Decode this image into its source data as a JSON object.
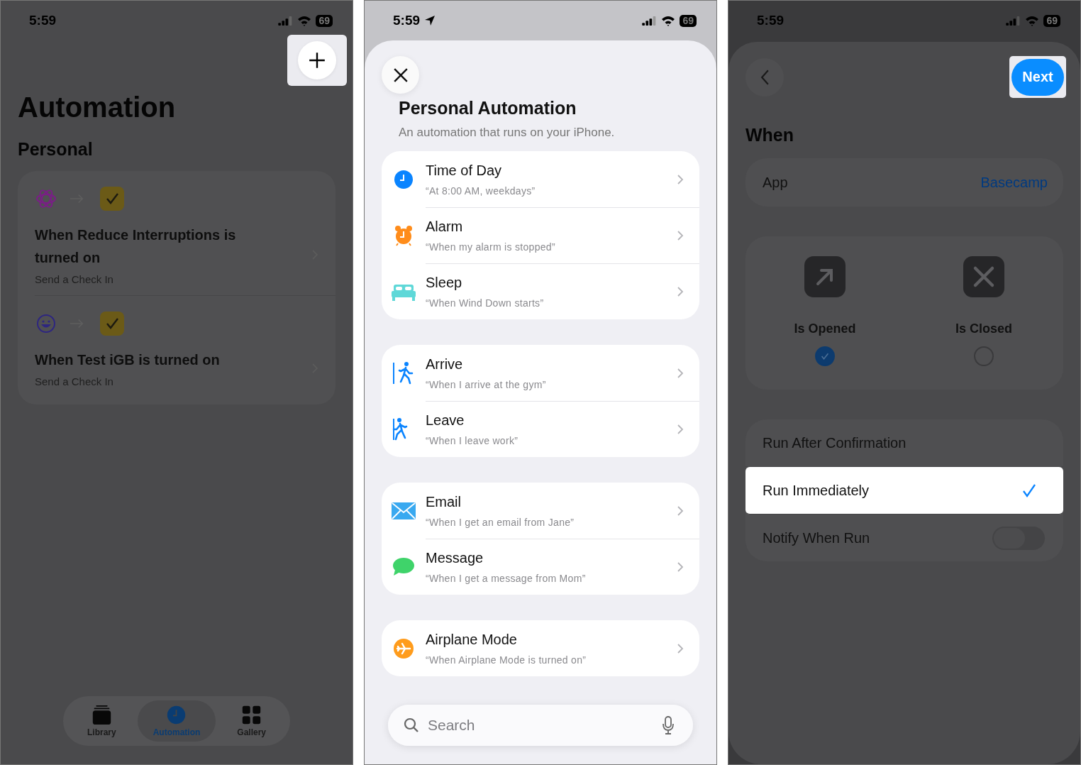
{
  "automation_screen": {
    "status_bar": {
      "time": "5:59",
      "battery": "69"
    },
    "title": "Automation",
    "section": "Personal",
    "automations": [
      {
        "kind": "flower",
        "title": "When Reduce Interruptions is turned on",
        "subtitle": "Send a Check In"
      },
      {
        "kind": "smiley",
        "title": "When Test iGB is turned on",
        "subtitle": "Send a Check In"
      }
    ],
    "tab_bar": [
      {
        "kind": "library",
        "label": "Library",
        "selected": false
      },
      {
        "kind": "clock",
        "label": "Automation",
        "selected": true
      },
      {
        "kind": "gallery",
        "label": "Gallery",
        "selected": false
      }
    ]
  },
  "trigger_sheet": {
    "status_bar": {
      "time": "5:59",
      "battery": "69",
      "location": true
    },
    "title": "Personal Automation",
    "subtitle": "An automation that runs on your iPhone.",
    "groups": [
      [
        {
          "kind": "clock",
          "title": "Time of Day",
          "subtitle": "“At 8:00 AM, weekdays”"
        },
        {
          "kind": "alarm",
          "title": "Alarm",
          "subtitle": "“When my alarm is stopped”"
        },
        {
          "kind": "bed",
          "title": "Sleep",
          "subtitle": "“When Wind Down starts”"
        }
      ],
      [
        {
          "kind": "arrive",
          "title": "Arrive",
          "subtitle": "“When I arrive at the gym”"
        },
        {
          "kind": "leave",
          "title": "Leave",
          "subtitle": "“When I leave work”"
        }
      ],
      [
        {
          "kind": "mail",
          "title": "Email",
          "subtitle": "“When I get an email from Jane”"
        },
        {
          "kind": "message",
          "title": "Message",
          "subtitle": "“When I get a message from Mom”"
        }
      ],
      [
        {
          "kind": "airplane",
          "title": "Airplane Mode",
          "subtitle": "“When Airplane Mode is turned on”"
        }
      ]
    ],
    "search": {
      "placeholder": "Search"
    }
  },
  "when_screen": {
    "status_bar": {
      "time": "5:59",
      "battery": "69"
    },
    "next_button": "Next",
    "title": "When",
    "app_row": {
      "label": "App",
      "value": "Basecamp"
    },
    "states": [
      {
        "kind": "open",
        "label": "Is Opened",
        "selected": true
      },
      {
        "kind": "close",
        "label": "Is Closed",
        "selected": false
      }
    ],
    "run_options": [
      {
        "label": "Run After Confirmation",
        "selected": false
      },
      {
        "label": "Run Immediately",
        "selected": true
      }
    ],
    "notify": {
      "label": "Notify When Run",
      "on": false
    }
  }
}
